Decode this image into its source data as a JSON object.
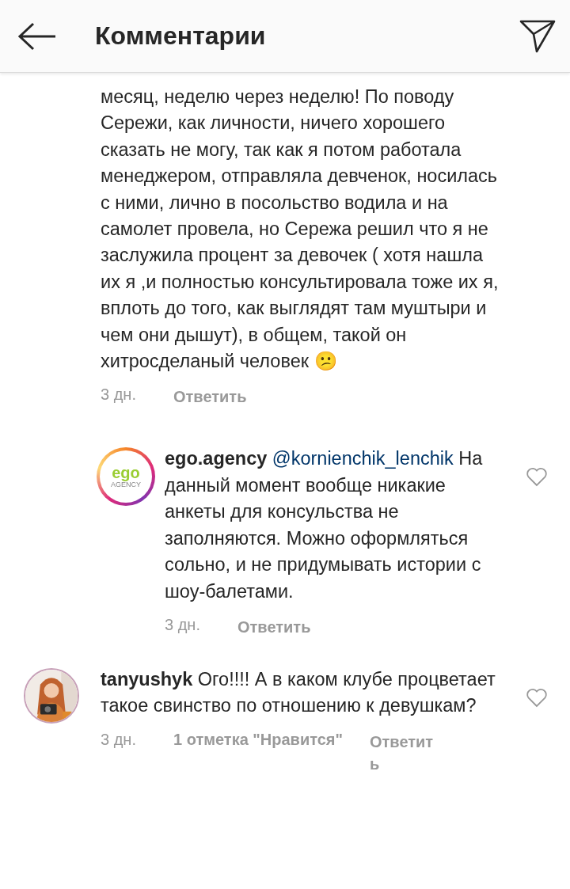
{
  "header": {
    "title": "Комментарии"
  },
  "comments": [
    {
      "kind": "continuation",
      "text": "месяц, неделю через неделю!  По поводу Сережи, как личности, ничего хорошего сказать не могу, так как я потом работала менеджером, отправляла девченок, носилась с ними, лично в посольство водила и на самолет провела, но Сережа решил что я не заслужила процент за девочек ( хотя нашла их  я ,и полностью консультировала тоже их я, вплоть до того, как выглядят там муштыри и чем они дышут), в общем, такой он хитросделаный человек 😕",
      "time": "3 дн.",
      "reply": "Ответить"
    },
    {
      "kind": "reply",
      "avatar": {
        "kind": "logo",
        "logo_text": "ego",
        "logo_subtext": "AGENCY"
      },
      "username": "ego.agency",
      "mention": "@kornienchik_lenchik",
      "text": "На данный момент вообще никакие анкеты для консульства не заполняются. Можно оформляться сольно, и не придумывать истории с шоу-балетами.",
      "time": "3 дн.",
      "reply": "Ответить",
      "liked": false
    },
    {
      "kind": "top",
      "username": "tanyushyk",
      "text": "Ого!!!! А в каком клубе процветает такое свинство по отношению к девушкам?",
      "time": "3 дн.",
      "likes": "1 отметка \"Нравится\"",
      "reply": "Ответить",
      "liked": false
    }
  ]
}
